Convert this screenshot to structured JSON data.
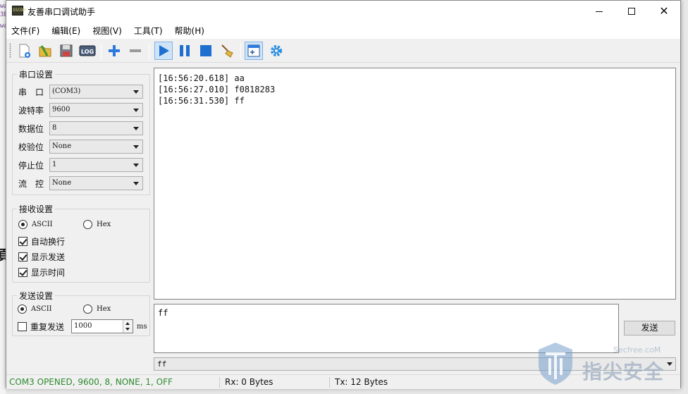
{
  "window": {
    "title": "友善串口调试助手",
    "icon_label": "SSCOM"
  },
  "menu": [
    "文件(F)",
    "编辑(E)",
    "视图(V)",
    "工具(T)",
    "帮助(H)"
  ],
  "toolbar": {
    "log_label": "LOG"
  },
  "serial_settings": {
    "title": "串口设置",
    "fields": [
      {
        "label": "串　口",
        "value": "(COM3)"
      },
      {
        "label": "波特率",
        "value": "9600"
      },
      {
        "label": "数据位",
        "value": "8"
      },
      {
        "label": "校验位",
        "value": "None"
      },
      {
        "label": "停止位",
        "value": "1"
      },
      {
        "label": "流　控",
        "value": "None"
      }
    ]
  },
  "receive_settings": {
    "title": "接收设置",
    "ascii": "ASCII",
    "hex": "Hex",
    "auto_newline": "自动换行",
    "show_send": "显示发送",
    "show_time": "显示时间"
  },
  "send_settings": {
    "title": "发送设置",
    "ascii": "ASCII",
    "hex": "Hex",
    "repeat": "重复发送",
    "interval": "1000",
    "unit": "ms"
  },
  "receive_log": [
    "[16:56:20.618] aa",
    "[16:56:27.010] f0818283",
    "[16:56:31.530] ff"
  ],
  "send_text": "ff",
  "send_button": "发送",
  "history_value": "ff",
  "status": {
    "port": "COM3 OPENED, 9600, 8, NONE, 1, OFF",
    "rx": "Rx: 0 Bytes",
    "tx": "Tx: 12 Bytes"
  },
  "colors": {
    "status_port": "#2e8b2e",
    "accent_blue": "#1e6fd0"
  },
  "watermark": {
    "site": "Secfree.coM",
    "text": "指尖安全"
  }
}
